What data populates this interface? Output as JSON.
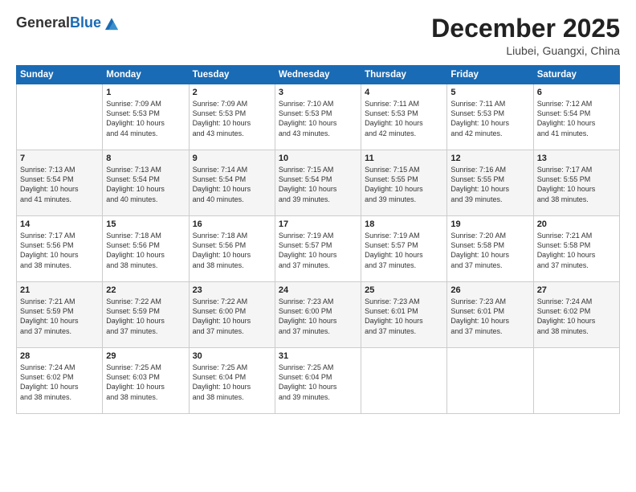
{
  "header": {
    "logo_general": "General",
    "logo_blue": "Blue",
    "month_year": "December 2025",
    "location": "Liubei, Guangxi, China"
  },
  "weekdays": [
    "Sunday",
    "Monday",
    "Tuesday",
    "Wednesday",
    "Thursday",
    "Friday",
    "Saturday"
  ],
  "weeks": [
    [
      {
        "day": "",
        "info": ""
      },
      {
        "day": "1",
        "info": "Sunrise: 7:09 AM\nSunset: 5:53 PM\nDaylight: 10 hours\nand 44 minutes."
      },
      {
        "day": "2",
        "info": "Sunrise: 7:09 AM\nSunset: 5:53 PM\nDaylight: 10 hours\nand 43 minutes."
      },
      {
        "day": "3",
        "info": "Sunrise: 7:10 AM\nSunset: 5:53 PM\nDaylight: 10 hours\nand 43 minutes."
      },
      {
        "day": "4",
        "info": "Sunrise: 7:11 AM\nSunset: 5:53 PM\nDaylight: 10 hours\nand 42 minutes."
      },
      {
        "day": "5",
        "info": "Sunrise: 7:11 AM\nSunset: 5:53 PM\nDaylight: 10 hours\nand 42 minutes."
      },
      {
        "day": "6",
        "info": "Sunrise: 7:12 AM\nSunset: 5:54 PM\nDaylight: 10 hours\nand 41 minutes."
      }
    ],
    [
      {
        "day": "7",
        "info": "Sunrise: 7:13 AM\nSunset: 5:54 PM\nDaylight: 10 hours\nand 41 minutes."
      },
      {
        "day": "8",
        "info": "Sunrise: 7:13 AM\nSunset: 5:54 PM\nDaylight: 10 hours\nand 40 minutes."
      },
      {
        "day": "9",
        "info": "Sunrise: 7:14 AM\nSunset: 5:54 PM\nDaylight: 10 hours\nand 40 minutes."
      },
      {
        "day": "10",
        "info": "Sunrise: 7:15 AM\nSunset: 5:54 PM\nDaylight: 10 hours\nand 39 minutes."
      },
      {
        "day": "11",
        "info": "Sunrise: 7:15 AM\nSunset: 5:55 PM\nDaylight: 10 hours\nand 39 minutes."
      },
      {
        "day": "12",
        "info": "Sunrise: 7:16 AM\nSunset: 5:55 PM\nDaylight: 10 hours\nand 39 minutes."
      },
      {
        "day": "13",
        "info": "Sunrise: 7:17 AM\nSunset: 5:55 PM\nDaylight: 10 hours\nand 38 minutes."
      }
    ],
    [
      {
        "day": "14",
        "info": "Sunrise: 7:17 AM\nSunset: 5:56 PM\nDaylight: 10 hours\nand 38 minutes."
      },
      {
        "day": "15",
        "info": "Sunrise: 7:18 AM\nSunset: 5:56 PM\nDaylight: 10 hours\nand 38 minutes."
      },
      {
        "day": "16",
        "info": "Sunrise: 7:18 AM\nSunset: 5:56 PM\nDaylight: 10 hours\nand 38 minutes."
      },
      {
        "day": "17",
        "info": "Sunrise: 7:19 AM\nSunset: 5:57 PM\nDaylight: 10 hours\nand 37 minutes."
      },
      {
        "day": "18",
        "info": "Sunrise: 7:19 AM\nSunset: 5:57 PM\nDaylight: 10 hours\nand 37 minutes."
      },
      {
        "day": "19",
        "info": "Sunrise: 7:20 AM\nSunset: 5:58 PM\nDaylight: 10 hours\nand 37 minutes."
      },
      {
        "day": "20",
        "info": "Sunrise: 7:21 AM\nSunset: 5:58 PM\nDaylight: 10 hours\nand 37 minutes."
      }
    ],
    [
      {
        "day": "21",
        "info": "Sunrise: 7:21 AM\nSunset: 5:59 PM\nDaylight: 10 hours\nand 37 minutes."
      },
      {
        "day": "22",
        "info": "Sunrise: 7:22 AM\nSunset: 5:59 PM\nDaylight: 10 hours\nand 37 minutes."
      },
      {
        "day": "23",
        "info": "Sunrise: 7:22 AM\nSunset: 6:00 PM\nDaylight: 10 hours\nand 37 minutes."
      },
      {
        "day": "24",
        "info": "Sunrise: 7:23 AM\nSunset: 6:00 PM\nDaylight: 10 hours\nand 37 minutes."
      },
      {
        "day": "25",
        "info": "Sunrise: 7:23 AM\nSunset: 6:01 PM\nDaylight: 10 hours\nand 37 minutes."
      },
      {
        "day": "26",
        "info": "Sunrise: 7:23 AM\nSunset: 6:01 PM\nDaylight: 10 hours\nand 37 minutes."
      },
      {
        "day": "27",
        "info": "Sunrise: 7:24 AM\nSunset: 6:02 PM\nDaylight: 10 hours\nand 38 minutes."
      }
    ],
    [
      {
        "day": "28",
        "info": "Sunrise: 7:24 AM\nSunset: 6:02 PM\nDaylight: 10 hours\nand 38 minutes."
      },
      {
        "day": "29",
        "info": "Sunrise: 7:25 AM\nSunset: 6:03 PM\nDaylight: 10 hours\nand 38 minutes."
      },
      {
        "day": "30",
        "info": "Sunrise: 7:25 AM\nSunset: 6:04 PM\nDaylight: 10 hours\nand 38 minutes."
      },
      {
        "day": "31",
        "info": "Sunrise: 7:25 AM\nSunset: 6:04 PM\nDaylight: 10 hours\nand 39 minutes."
      },
      {
        "day": "",
        "info": ""
      },
      {
        "day": "",
        "info": ""
      },
      {
        "day": "",
        "info": ""
      }
    ]
  ]
}
